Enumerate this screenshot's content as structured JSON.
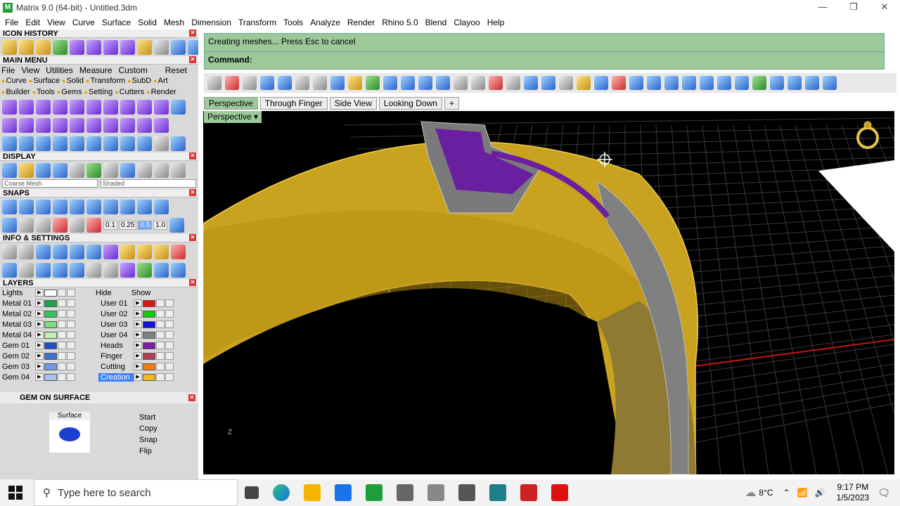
{
  "window": {
    "title": "Matrix 9.0 (64-bit) - Untitled.3dm",
    "controls": {
      "min": "—",
      "max": "❐",
      "close": "✕"
    }
  },
  "menu": [
    "File",
    "Edit",
    "View",
    "Curve",
    "Surface",
    "Solid",
    "Mesh",
    "Dimension",
    "Transform",
    "Tools",
    "Analyze",
    "Render",
    "Rhino 5.0",
    "Blend",
    "Clayoo",
    "Help"
  ],
  "panels": {
    "icon_history": "ICON HISTORY",
    "main_menu": {
      "title": "MAIN MENU",
      "items": [
        "File",
        "View",
        "Utilities",
        "Measure",
        "Custom"
      ],
      "reset": "Reset",
      "tags1": [
        "Curve",
        "Surface",
        "Solid",
        "Transform",
        "SubD",
        "Art"
      ],
      "tags2": [
        "Builder",
        "Tools",
        "Gems",
        "Setting",
        "Cutters",
        "Render"
      ]
    },
    "display": {
      "title": "DISPLAY",
      "mode1": "Coarse Mesh",
      "mode2": "Shaded"
    },
    "snaps": {
      "title": "SNAPS",
      "values": [
        "0.1",
        "0.25",
        "0.5",
        "1.0"
      ],
      "active": "0.5"
    },
    "info": "INFO & SETTINGS",
    "layers": {
      "title": "LAYERS",
      "lights": "Lights",
      "hide": "Hide",
      "show": "Show",
      "left": [
        {
          "name": "Metal 01",
          "color": "#1fa34a"
        },
        {
          "name": "Metal 02",
          "color": "#35c25f"
        },
        {
          "name": "Metal 03",
          "color": "#7be07b"
        },
        {
          "name": "Metal 04",
          "color": "#bff2b4"
        },
        {
          "name": "Gem 01",
          "color": "#1c4fbf"
        },
        {
          "name": "Gem 02",
          "color": "#3b73d6"
        },
        {
          "name": "Gem 03",
          "color": "#6f9ae6"
        },
        {
          "name": "Gem 04",
          "color": "#a9c3f0"
        }
      ],
      "right": [
        {
          "name": "User 01",
          "color": "#e01313"
        },
        {
          "name": "User 02",
          "color": "#10cc10"
        },
        {
          "name": "User 03",
          "color": "#1010e0"
        },
        {
          "name": "User 04",
          "color": "#808080"
        },
        {
          "name": "Heads",
          "color": "#7a1fa6"
        },
        {
          "name": "Finger",
          "color": "#b04050"
        },
        {
          "name": "Cutting",
          "color": "#f07d10"
        },
        {
          "name": "Creation",
          "color": "#f5b81a"
        }
      ]
    },
    "gem_on_surface": {
      "title": "GEM ON SURFACE",
      "preview_label": "Surface",
      "buttons": [
        "Start",
        "Copy",
        "Snap",
        "Flip"
      ]
    }
  },
  "command": {
    "line1": "Creating meshes... Press Esc to cancel",
    "line2": "Command:"
  },
  "view_tabs": [
    "Perspective",
    "Through Finger",
    "Side View",
    "Looking Down"
  ],
  "view_tab_add": "+",
  "viewport_label": "Perspective",
  "axis_label": "Z",
  "taskbar": {
    "search": "Type here to search",
    "weather": "8°C",
    "time": "9:17 PM",
    "date": "1/5/2023"
  }
}
